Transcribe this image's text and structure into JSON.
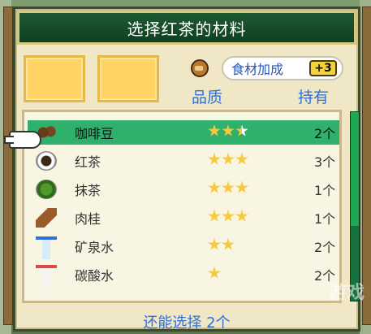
{
  "dialog": {
    "title": "选择红茶的材料",
    "bonus_label": "食材加成",
    "bonus_value": "+3",
    "columns": {
      "quality": "品质",
      "owned": "持有"
    },
    "remaining_text": "还能选择 2个"
  },
  "ingredients": [
    {
      "name": "咖啡豆",
      "count": "2个",
      "stars": 2.5,
      "icon": "coffee-beans-icon",
      "selected": true
    },
    {
      "name": "红茶",
      "count": "3个",
      "stars": 3,
      "icon": "black-tea-icon",
      "selected": false
    },
    {
      "name": "抹茶",
      "count": "1个",
      "stars": 3,
      "icon": "matcha-icon",
      "selected": false
    },
    {
      "name": "肉桂",
      "count": "1个",
      "stars": 3,
      "icon": "cinnamon-icon",
      "selected": false
    },
    {
      "name": "矿泉水",
      "count": "2个",
      "stars": 2,
      "icon": "mineral-water-icon",
      "selected": false
    },
    {
      "name": "碳酸水",
      "count": "2个",
      "stars": 1,
      "icon": "soda-water-icon",
      "selected": false
    }
  ],
  "watermark": "游戏",
  "colors": {
    "accent": "#2f6fd6",
    "selection": "#2fb06c",
    "title_bg": "#0f3f21"
  }
}
